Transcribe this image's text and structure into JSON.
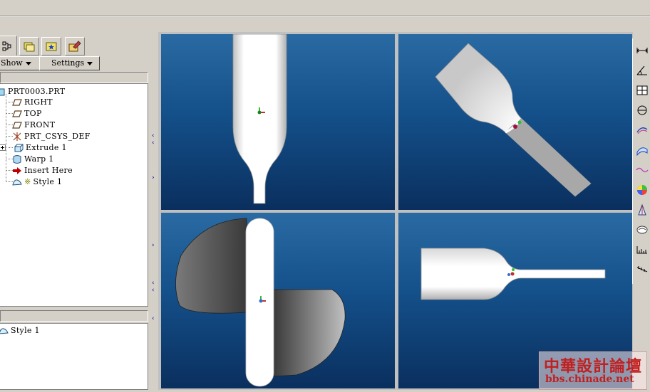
{
  "panel": {
    "show_button": "Show",
    "settings_button": "Settings"
  },
  "tree": {
    "root": "PRT0003.PRT",
    "items": [
      {
        "label": "RIGHT",
        "icon": "datum-plane-icon"
      },
      {
        "label": "TOP",
        "icon": "datum-plane-icon"
      },
      {
        "label": "FRONT",
        "icon": "datum-plane-icon"
      },
      {
        "label": "PRT_CSYS_DEF",
        "icon": "csys-icon"
      },
      {
        "label": "Extrude 1",
        "icon": "extrude-icon"
      },
      {
        "label": "Warp 1",
        "icon": "warp-icon"
      },
      {
        "label": "Insert Here",
        "icon": "insert-arrow-icon"
      },
      {
        "label": "Style 1",
        "icon": "style-icon"
      }
    ]
  },
  "style_tree": {
    "items": [
      {
        "label": "Style 1",
        "icon": "style-icon"
      }
    ]
  },
  "watermark": {
    "title": "中華設計論壇",
    "url": "bbs.chinade.net"
  },
  "colors": {
    "viewport_top": "#2a6aa3",
    "viewport_bottom": "#0a2f5e",
    "watermark": "#c02020"
  }
}
